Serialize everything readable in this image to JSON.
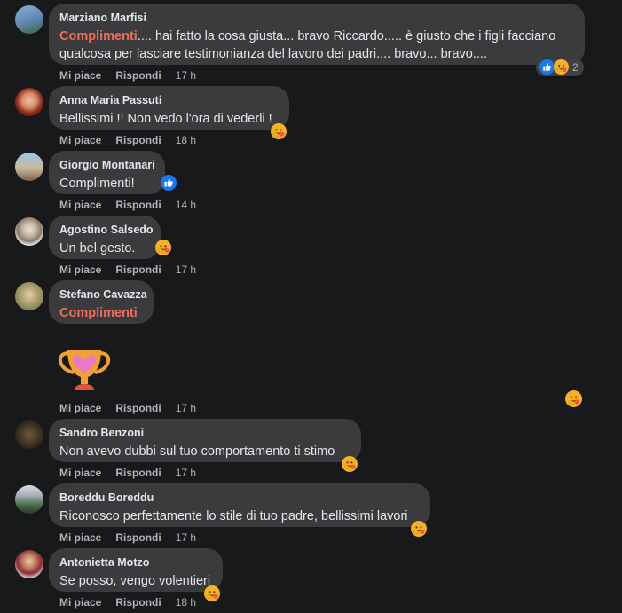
{
  "actions": {
    "like": "Mi piace",
    "reply": "Rispondi"
  },
  "comments": [
    {
      "author": "Marziano Marfisi",
      "highlight": "Complimenti",
      "text_line1": ".... hai fatto la cosa giusta... bravo Riccardo..... è giusto che i figli facciano",
      "text_line2": "qualcosa per lasciare testimonianza del lavoro dei padri.... bravo... bravo....",
      "time": "17 h",
      "reactions": [
        "like",
        "care"
      ],
      "reaction_count": "2"
    },
    {
      "author": "Anna Maria Passuti",
      "text": "Bellissimi !! Non vedo l'ora di vederli !",
      "time": "18 h",
      "reactions": [
        "care"
      ]
    },
    {
      "author": "Giorgio Montanari",
      "text": "Complimenti!",
      "time": "14 h",
      "reactions": [
        "like"
      ]
    },
    {
      "author": "Agostino Salsedo",
      "text": "Un bel gesto.",
      "time": "17 h",
      "reactions": [
        "care"
      ]
    },
    {
      "author": "Stefano Cavazza",
      "highlight": "Complimenti",
      "time": "17 h",
      "sticker": "trophy",
      "reactions": [
        "care"
      ]
    },
    {
      "author": "Sandro Benzoni",
      "text": "Non avevo dubbi sul tuo comportamento ti stimo",
      "time": "17 h",
      "reactions": [
        "care"
      ]
    },
    {
      "author": "Boreddu Boreddu",
      "text": "Riconosco perfettamente lo stile di tuo padre, bellissimi lavori",
      "time": "17 h",
      "reactions": [
        "care"
      ]
    },
    {
      "author": "Antonietta Motzo",
      "text": "Se posso, vengo volentieri",
      "time": "18 h",
      "reactions": [
        "care"
      ]
    }
  ],
  "colors": {
    "background": "#18191a",
    "bubble": "#3a3b3c",
    "highlight": "#f26b5b",
    "secondary_text": "#b0b3b8",
    "like_blue": "#1877f2",
    "care_yellow": "#f7b125"
  }
}
